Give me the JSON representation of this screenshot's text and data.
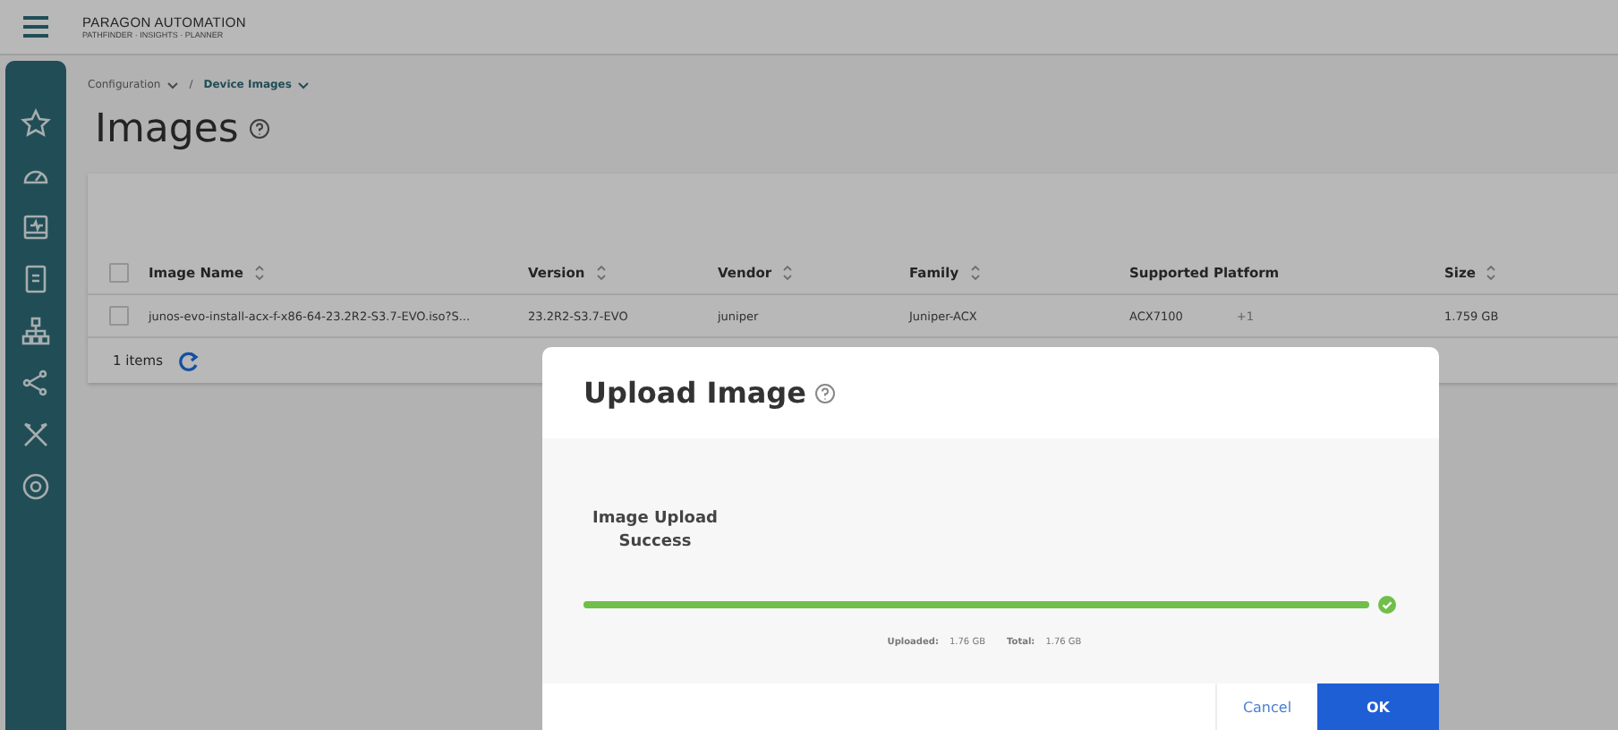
{
  "header": {
    "brand": "PARAGON AUTOMATION",
    "subtitle": "PATHFINDER · INSIGHTS · PLANNER"
  },
  "breadcrumb": [
    {
      "label": "Configuration",
      "current": false
    },
    {
      "label": "Device Images",
      "current": true
    }
  ],
  "breadcrumb_separator": "/",
  "page_title": "Images",
  "table": {
    "select_all": {
      "checked": false
    },
    "columns": [
      {
        "label": "Image Name",
        "sortable": true
      },
      {
        "label": "Version",
        "sortable": true
      },
      {
        "label": "Vendor",
        "sortable": true
      },
      {
        "label": "Family",
        "sortable": true
      },
      {
        "label": "Supported Platform",
        "sortable": false
      },
      {
        "label": "Size",
        "sortable": true
      }
    ],
    "rows": [
      {
        "checked": false,
        "cells": [
          "junos-evo-install-acx-f-x86-64-23.2R2-S3.7-EVO.iso?S...",
          "23.2R2-S3.7-EVO",
          "juniper",
          "Juniper-ACX",
          "ACX7100",
          "1.759 GB"
        ],
        "extra_platforms": "+1"
      }
    ],
    "footer": {
      "count": "1 items"
    }
  },
  "dialog": {
    "title": "Upload Image",
    "status": "Image Upload Success",
    "progress": {
      "level": 1.0,
      "complete": true
    },
    "uploaded_label": "Uploaded:",
    "uploaded": "1.76 GB",
    "total_label": "Total:",
    "total": "1.76 GB",
    "buttons": [
      {
        "label": "Cancel",
        "kind": "secondary"
      },
      {
        "label": "OK",
        "kind": "primary"
      }
    ]
  }
}
